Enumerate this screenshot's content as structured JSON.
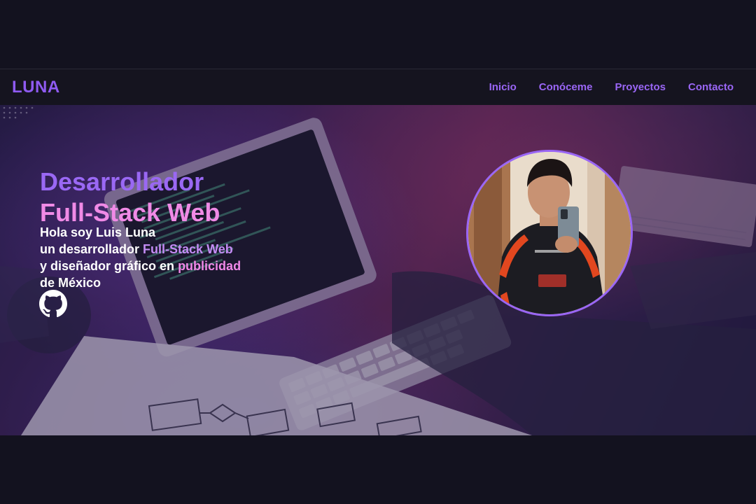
{
  "navbar": {
    "brand": "LUNA",
    "links": [
      {
        "label": "Inicio"
      },
      {
        "label": "Conóceme"
      },
      {
        "label": "Proyectos"
      },
      {
        "label": "Contacto"
      }
    ]
  },
  "hero": {
    "title_line1": "Desarrollador",
    "title_line2": "Full-Stack Web",
    "intro_line1": "Hola soy Luis Luna",
    "intro_line2_pre": "un desarrollador ",
    "intro_line2_hl": "Full-Stack Web",
    "intro_line3_pre": "y diseñador gráfico en ",
    "intro_line3_hl": "publicidad",
    "intro_line4": "de México",
    "github_icon": "github-icon",
    "avatar_alt": "profile-photo"
  },
  "colors": {
    "background": "#13121f",
    "brand": "#8f5bf2",
    "nav_link": "#9a66f5",
    "title_purple": "#9a68f4",
    "title_pink": "#f08ae6",
    "highlight_purple": "#c48cf5",
    "highlight_pink": "#f088e8"
  }
}
